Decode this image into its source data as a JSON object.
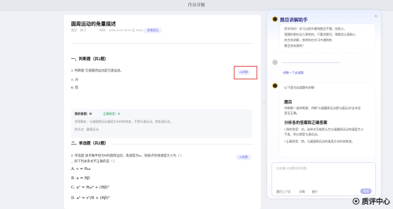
{
  "topbar": {
    "title": "作业详解"
  },
  "paper": {
    "title": "圆周运动的角量描述",
    "meta_grade": "类型：  练习",
    "meta_date": "时间：  2025-10-22 00:00  至  2025-10-22 23:59",
    "report_btn": "查看报告",
    "sec1_title": "一、判断题（共1题）",
    "q1": "1. 判断题 匀速圆周运动是匀速运动。",
    "opt_a": "A. 对",
    "opt_b": "B. 错",
    "ai_explain_btn": "AI讲解",
    "analysis_label": "我的答案：B",
    "analysis_correct": "正确答案：B",
    "analysis_line1": "答案解析：匀速圆周运动速度方向时刻改变，不是匀速运动，是变速运动。",
    "analysis_line2": "知识点：圆周运动",
    "sec2_title": "二、单选题（共2题）",
    "q2": "2. 单选题 质点做半径为R的圆周运动，角速度为ω，则质点的线速度大小为（  ）",
    "q2b": "，则下列关系式不正确的是（  ）",
    "ai_explain_btn2": "AI讲解",
    "m_a": "A.  v = Rω",
    "m_b": "B.  a = Rβ",
    "m_c": "C.  a² = Rω⁴ + (Rβ)²",
    "m_d": "D.  a² = v²/R + (Rβ)²"
  },
  "panel": {
    "title": "题目讲解助手",
    "intro1": "同学你好！学习过程中遇到题目不懂，别担心，",
    "intro2": "我随时都在这儿帮助你。只要你提问，我都会认真耐心",
    "intro3": "的为你讲解，快把你在学习中遇到的",
    "intro4": "题目发给我吧！",
    "user_q": "讲解一下这道题",
    "ans1": "以下是对这道题的讲解：",
    "ans_h1": "题目",
    "ans_t1": "判断题一道判断题，判断“匀速圆周运动是匀速运动”这句话",
    "ans_t2": "是否正确。",
    "ans_h2": "分析各的答案和正确答案",
    "ans_b1": "• 我的答案：对。选择对可能是认为匀速圆周运动的速度大小",
    "ans_b2": "  不变，所以就是匀速运动。",
    "ans_b3": "• 正确答案：错。匀速圆周运动的速度方向时刻改变。",
    "input_placeholder": "在此输入你想问的问题…",
    "tool1": "题目上下文",
    "tool2": "详情",
    "tool3": "图片",
    "send": "发送"
  },
  "watermark": {
    "text": "质评中心"
  }
}
